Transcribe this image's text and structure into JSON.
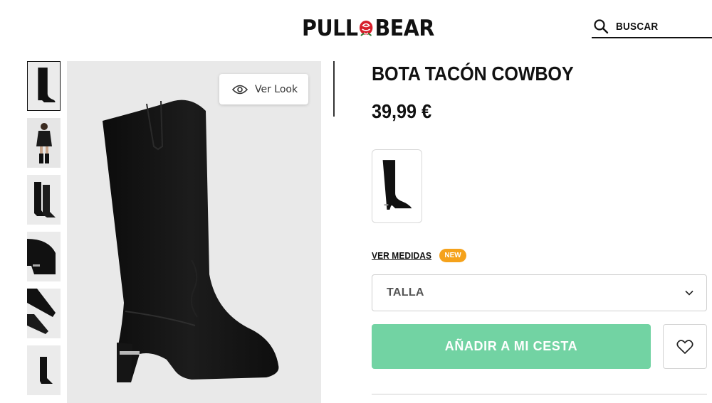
{
  "header": {
    "brand_left": "PULL",
    "brand_right": "BEAR",
    "logo_mark": "rose-icon",
    "search_label": "BUSCAR",
    "search_icon": "search-icon"
  },
  "gallery": {
    "thumbnails": [
      "boot-side",
      "model-wearing",
      "boots-pair",
      "heel-detail",
      "toe-detail",
      "boot-side-small"
    ],
    "active_index": 0,
    "ver_look_label": "Ver Look",
    "ver_look_icon": "eye-icon"
  },
  "product": {
    "title": "BOTA TACÓN COWBOY",
    "price": "39,99 €",
    "measures_link": "VER MEDIDAS",
    "new_badge": "NEW",
    "size_placeholder": "TALLA",
    "add_to_cart": "AÑADIR A MI CESTA",
    "wishlist_icon": "heart-icon"
  },
  "colors": {
    "accent_button": "#72d3a3",
    "new_badge": "#f5a21b",
    "image_bg": "#e9e9e9"
  }
}
